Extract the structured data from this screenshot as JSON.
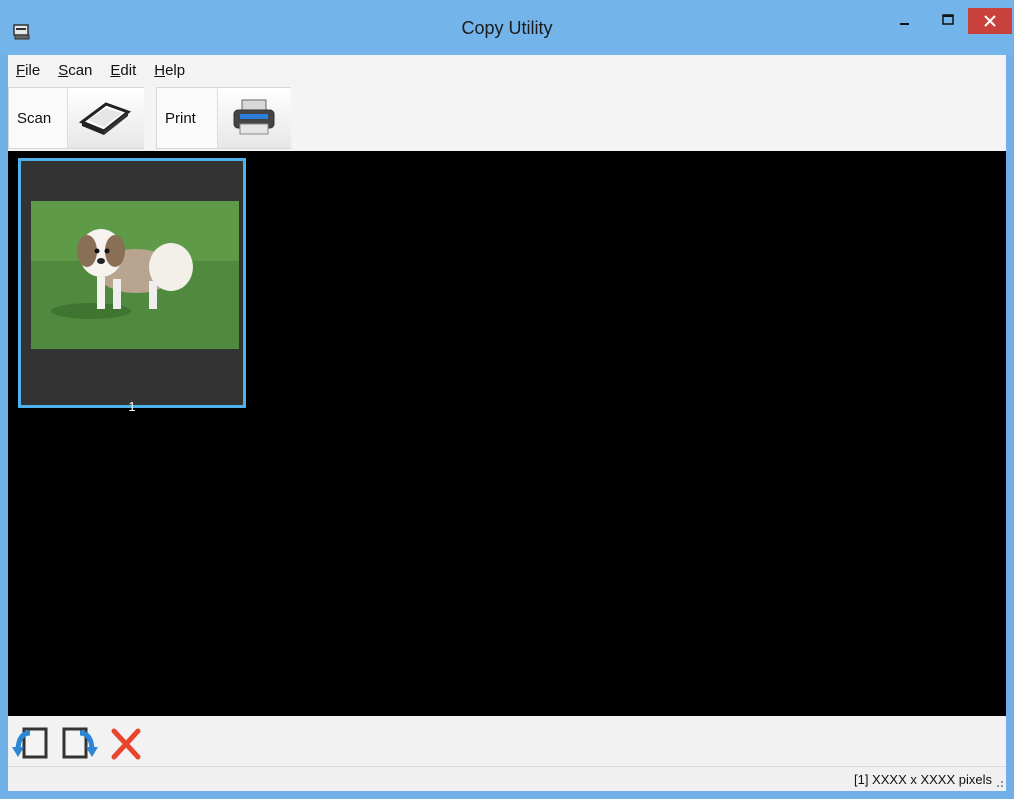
{
  "window": {
    "title": "Copy Utility"
  },
  "menu": {
    "file": {
      "key": "F",
      "rest": "ile"
    },
    "scan": {
      "key": "S",
      "rest": "can"
    },
    "edit": {
      "key": "E",
      "rest": "dit"
    },
    "help": {
      "key": "H",
      "rest": "elp"
    }
  },
  "toolbar": {
    "scan_label": "Scan",
    "print_label": "Print"
  },
  "thumbnails": [
    {
      "page_number": "1"
    }
  ],
  "statusbar": {
    "text": "[1] XXXX x XXXX pixels"
  },
  "icons": {
    "app": "app-scanner-icon",
    "scan": "flatbed-scanner-icon",
    "print": "printer-icon",
    "rotate_left": "rotate-left-icon",
    "rotate_right": "rotate-right-icon",
    "delete": "delete-x-icon"
  },
  "colors": {
    "titlebar": "#73b4ea",
    "close_button": "#c8413a",
    "selection_border": "#4db3ea",
    "viewer_background": "#000000",
    "delete_icon": "#e8452c"
  }
}
